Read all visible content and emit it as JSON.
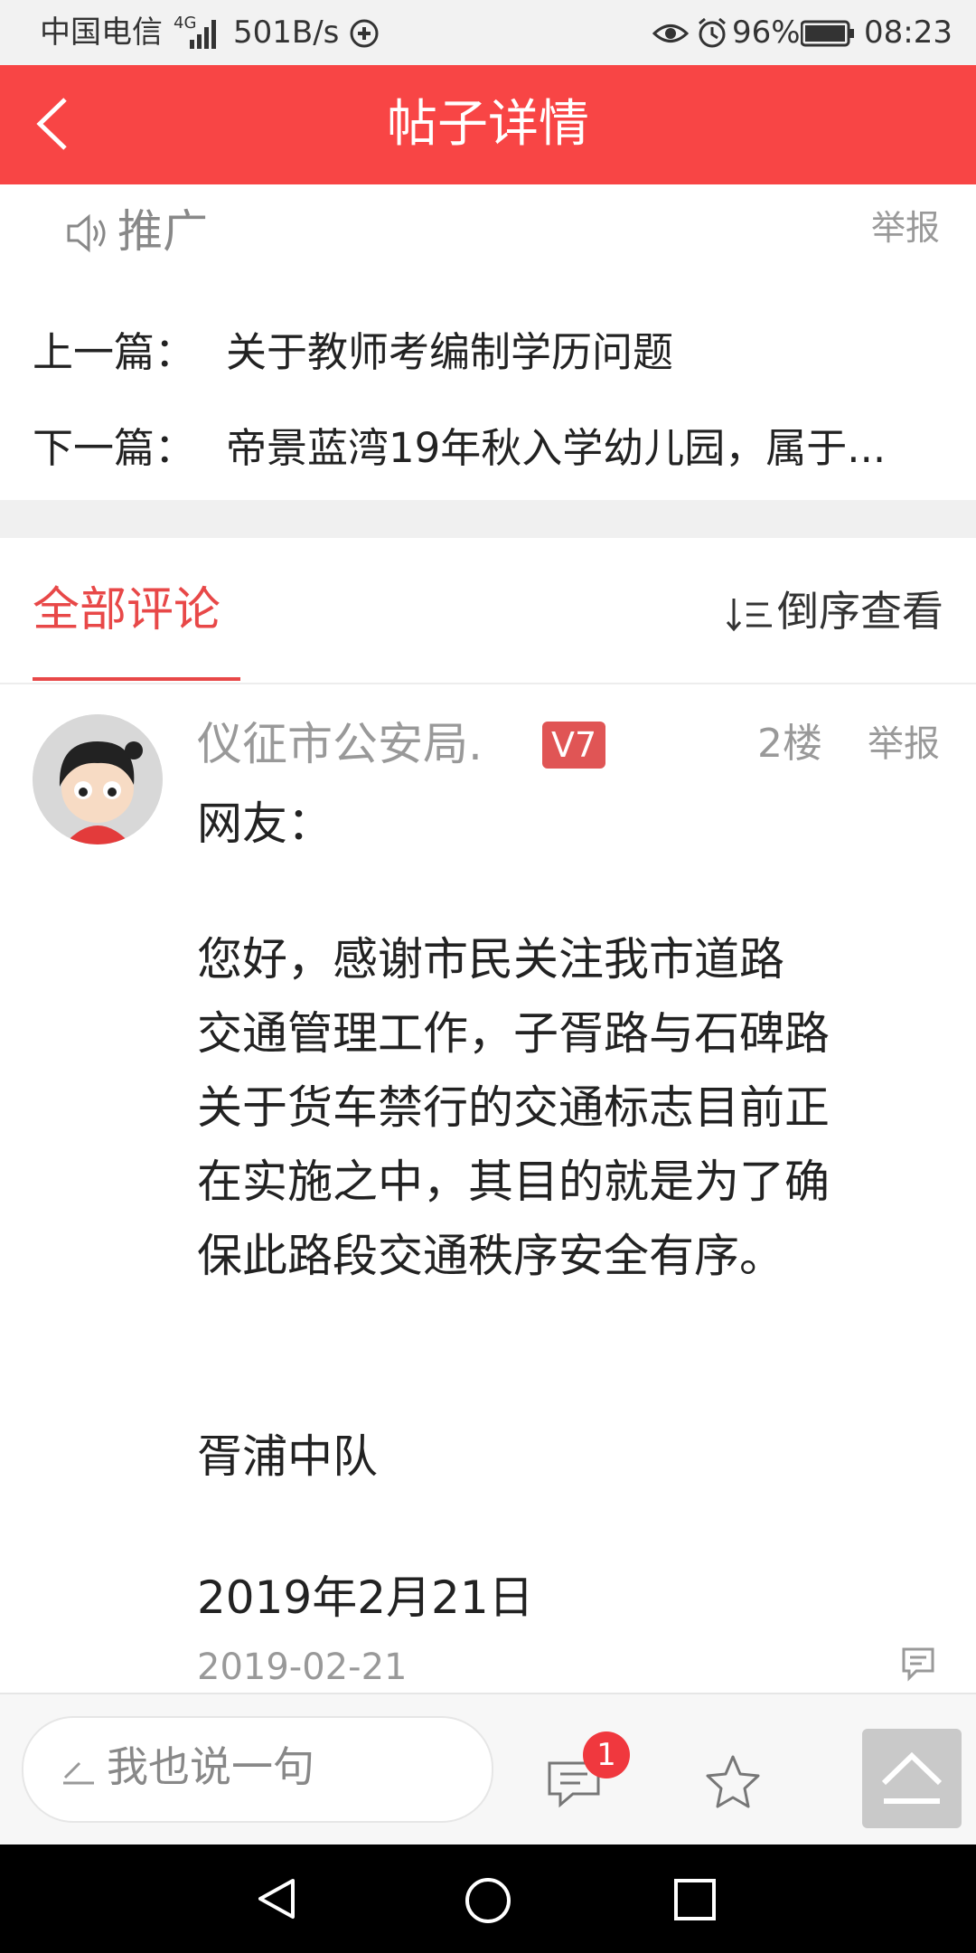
{
  "status_bar": {
    "carrier": "中国电信",
    "network": "4G",
    "speed": "501B/s",
    "battery": "96%",
    "time": "08:23"
  },
  "header": {
    "title": "帖子详情"
  },
  "promo": {
    "label": "推广",
    "report": "举报"
  },
  "navigation": {
    "prev_label": "上一篇：",
    "prev_title": "关于教师考编制学历问题",
    "next_label": "下一篇：",
    "next_title": "帝景蓝湾19年秋入学幼儿园，属于..."
  },
  "comments": {
    "tab_label": "全部评论",
    "sort_label": "倒序查看",
    "items": [
      {
        "username": "仪征市公安局.",
        "level": "V7",
        "floor": "2楼",
        "report": "举报",
        "lines": [
          "网友：",
          "",
          "  您好，感谢市民关注我市道路",
          "交通管理工作，子胥路与石碑路",
          "关于货车禁行的交通标志目前正",
          "在实施之中，其目的就是为了确",
          "保此路段交通秩序安全有序。",
          "",
          "",
          " 胥浦中队",
          "",
          " 2019年2月21日"
        ],
        "date": "2019-02-21"
      }
    ]
  },
  "bottom_bar": {
    "input_placeholder": "我也说一句",
    "comment_count": "1"
  },
  "colors": {
    "accent": "#f84545",
    "tab_active": "#e84848",
    "badge": "#e05555"
  }
}
